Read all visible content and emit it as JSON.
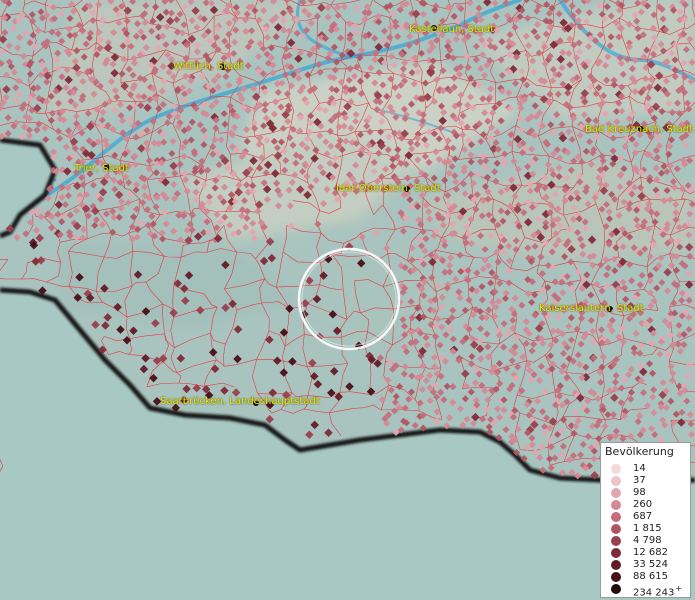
{
  "map": {
    "colors": {
      "land": "#a9c4bf",
      "plateau": "#c9d0c4",
      "water": "#3aa7d6",
      "boundary": "#e8323a",
      "border": "#141414",
      "magnifier": "#ffffff"
    },
    "cities": [
      {
        "id": "kastellaun",
        "label": "Kastellaun, Stadt"
      },
      {
        "id": "wittlich",
        "label": "Wittlich, Stadt"
      },
      {
        "id": "bad-kreuznach",
        "label": "Bad Kreuznach, Stadt"
      },
      {
        "id": "trier",
        "label": "Trier, Stadt"
      },
      {
        "id": "idar-oberstein",
        "label": "Idar-Oberstein, Stadt"
      },
      {
        "id": "kaiserslautern",
        "label": "Kaiserslautern, Stadt"
      },
      {
        "id": "saarbruecken",
        "label": "Saarbrücken, Landeshauptstadt"
      }
    ]
  },
  "legend": {
    "title": "Bevölkerung",
    "items": [
      {
        "label": "14",
        "color": "#f5d7dd"
      },
      {
        "label": "37",
        "color": "#eec3ca"
      },
      {
        "label": "98",
        "color": "#e1a6b0"
      },
      {
        "label": "260",
        "color": "#d48a96"
      },
      {
        "label": "687",
        "color": "#c46e7c"
      },
      {
        "label": "1 815",
        "color": "#b15664"
      },
      {
        "label": "4 798",
        "color": "#9a3f4d"
      },
      {
        "label": "12 682",
        "color": "#802b38"
      },
      {
        "label": "33 524",
        "color": "#631b26"
      },
      {
        "label": "88 615",
        "color": "#470f18"
      },
      {
        "label": "234 243",
        "color": "#20080b",
        "plus": "+"
      }
    ]
  }
}
